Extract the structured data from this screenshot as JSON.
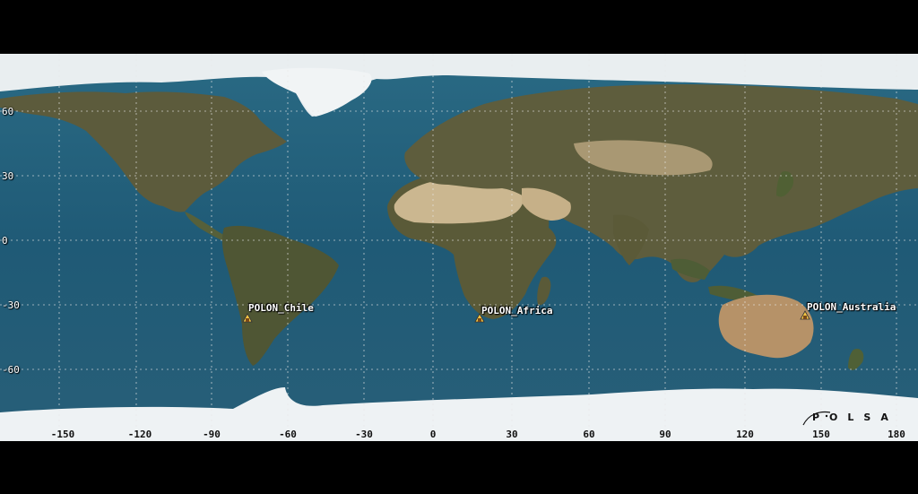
{
  "map": {
    "colors": {
      "ocean_deep": "#1b4a63",
      "ocean": "#2d6f8c",
      "shelf": "#3f8fa8",
      "land": "#5a5a3a",
      "desert": "#c9b48a",
      "ice": "#eef2f4",
      "grid": "#e8e8e8",
      "border": "#a7d9a0"
    },
    "lat_labels": [
      "60",
      "30",
      "0",
      "-30",
      "-60"
    ],
    "lon_labels": [
      "-150",
      "-120",
      "-90",
      "-60",
      "-30",
      "0",
      "30",
      "60",
      "90",
      "120",
      "150",
      "180"
    ],
    "stations": [
      {
        "name": "POLON_Chile",
        "icon": "telescope-station-icon"
      },
      {
        "name": "POLON_Africa",
        "icon": "telescope-station-icon"
      },
      {
        "name": "POLON_Australia",
        "icon": "telescope-station-icon"
      }
    ],
    "logo": "POLSA"
  }
}
